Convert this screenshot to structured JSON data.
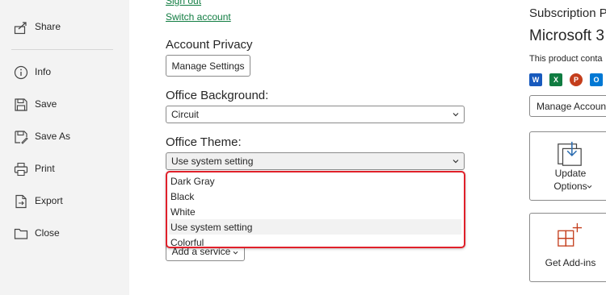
{
  "sidebar": {
    "items": [
      {
        "label": "Share",
        "icon": "share-icon"
      },
      {
        "label": "Info",
        "icon": "info-icon"
      },
      {
        "label": "Save",
        "icon": "save-icon"
      },
      {
        "label": "Save As",
        "icon": "save-as-icon"
      },
      {
        "label": "Print",
        "icon": "print-icon"
      },
      {
        "label": "Export",
        "icon": "export-icon"
      },
      {
        "label": "Close",
        "icon": "folder-icon"
      }
    ]
  },
  "account": {
    "sign_out": "Sign out",
    "switch_account": "Switch account"
  },
  "privacy": {
    "title": "Account Privacy",
    "manage_button": "Manage Settings"
  },
  "background": {
    "title": "Office Background:",
    "value": "Circuit"
  },
  "theme": {
    "title": "Office Theme:",
    "value": "Use system setting",
    "options": [
      "Dark Gray",
      "Black",
      "White",
      "Use system setting",
      "Colorful"
    ],
    "selected": "Use system setting"
  },
  "services": {
    "add_button": "Add a service"
  },
  "subscription": {
    "heading": "Subscription P",
    "product": "Microsoft 3",
    "contains": "This product conta",
    "manage_button": "Manage Accoun",
    "update_label_1": "Update",
    "update_label_2": "Options",
    "addins_label": "Get Add-ins"
  },
  "apps": [
    {
      "name": "Word",
      "letter": "W",
      "color": "#185abd"
    },
    {
      "name": "Excel",
      "letter": "X",
      "color": "#107c41"
    },
    {
      "name": "PowerPoint",
      "letter": "P",
      "color": "#c43e1c"
    },
    {
      "name": "Outlook",
      "letter": "O",
      "color": "#0078d4"
    }
  ],
  "colors": {
    "accent": "#107c41",
    "highlight": "#e0202a",
    "sidebar_bg": "#f3f3f3"
  }
}
